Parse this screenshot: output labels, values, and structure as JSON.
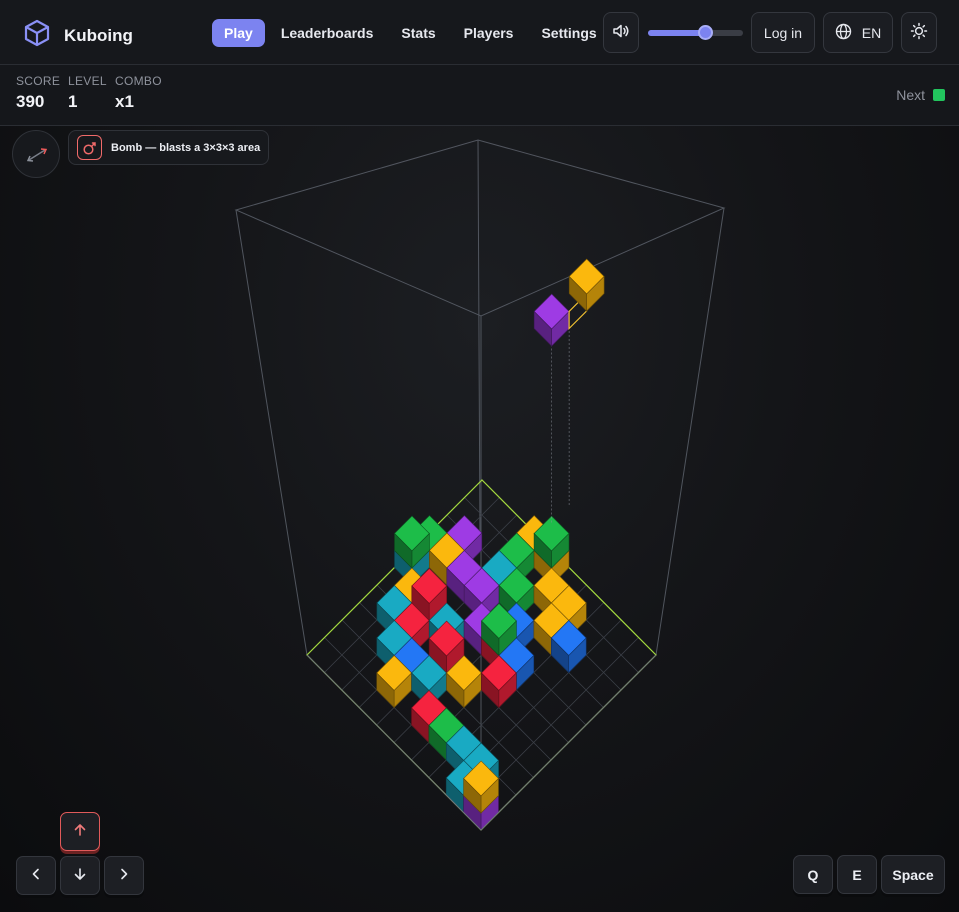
{
  "app": {
    "name": "Kuboing",
    "logo_icon": "cube-icon"
  },
  "nav": {
    "items": [
      {
        "label": "Play",
        "active": true
      },
      {
        "label": "Leaderboards",
        "active": false
      },
      {
        "label": "Stats",
        "active": false
      },
      {
        "label": "Players",
        "active": false
      },
      {
        "label": "Settings",
        "active": false
      }
    ]
  },
  "header": {
    "volume_icon": "speaker-icon",
    "volume_level": 0.6,
    "login_label": "Log in",
    "language_icon": "globe-icon",
    "language_label": "EN",
    "theme_icon": "sun-icon"
  },
  "hud": {
    "score_label": "SCORE",
    "score_value": "390",
    "level_label": "LEVEL",
    "level_value": "1",
    "combo_label": "COMBO",
    "combo_value": "x1",
    "next_label": "Next",
    "next_color": "#22c55e"
  },
  "powerup": {
    "icon": "bomb-icon",
    "text": "Bomb — blasts a 3×3×3 area"
  },
  "controls": {
    "up_icon": "arrow-up-icon",
    "left_icon": "arrow-left-icon",
    "down_icon": "arrow-down-icon",
    "right_icon": "arrow-right-icon",
    "q_label": "Q",
    "e_label": "E",
    "space_label": "Space"
  },
  "colors": {
    "accent": "#7c83f0",
    "purple": "#7e2fb6",
    "yellow": "#c9930a",
    "red": "#c41c32",
    "teal": "#14889c",
    "green": "#17973a",
    "blue": "#1c5fc4",
    "floor_outline": "#a3d93e"
  }
}
